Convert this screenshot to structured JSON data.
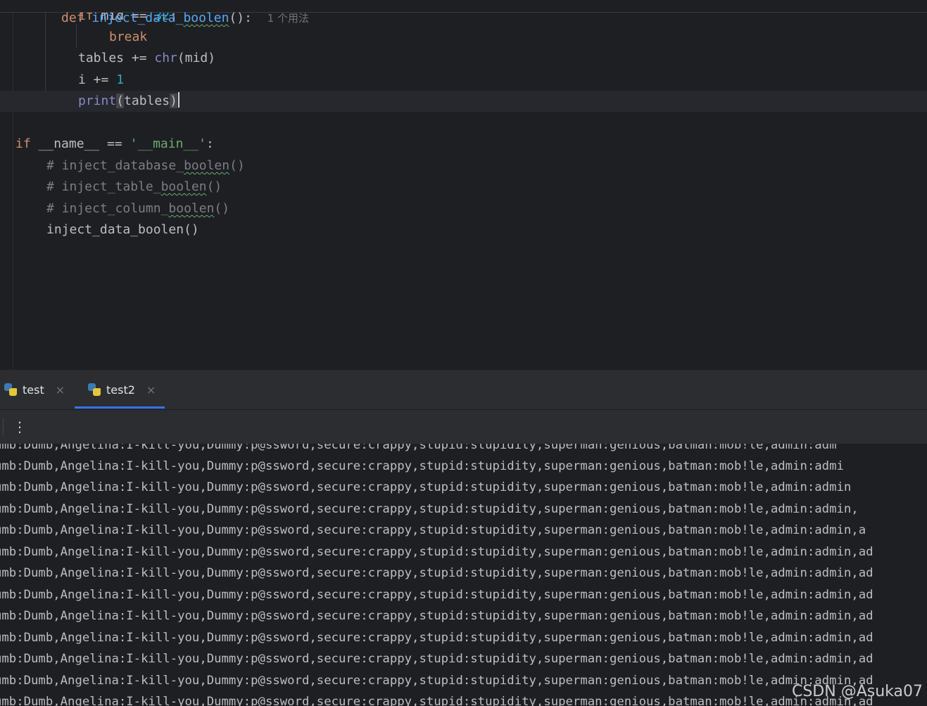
{
  "editor": {
    "sticky": {
      "kw": "def ",
      "fn": "inject_data_",
      "fn_squig": "boolen",
      "tail": "():",
      "hint": "1 个用法"
    },
    "lines": {
      "l0_kw": "if ",
      "l0_plain": "mid == ",
      "l0_num": "32",
      "l0_tail": ":",
      "l1_kw": "break",
      "l2_plain": "tables += ",
      "l2_builtin": "chr",
      "l2_tail": "(mid)",
      "l3_plain": "i += ",
      "l3_num": "1",
      "l4_builtin": "print",
      "l4_open": "(",
      "l4_arg": "tables",
      "l4_close": ")",
      "l6_kw": "if ",
      "l6_plain": "__name__ == ",
      "l6_str": "'__main__'",
      "l6_tail": ":",
      "l7_cmt": "# inject_database_",
      "l7_squig": "boolen",
      "l7_tail": "()",
      "l8_cmt": "# inject_table_",
      "l8_squig": "boolen",
      "l8_tail": "()",
      "l9_cmt": "# inject_column_",
      "l9_squig": "boolen",
      "l9_tail": "()",
      "l10_plain": "inject_data_boolen()"
    }
  },
  "run_panel": {
    "tabs": [
      {
        "label": "test",
        "close": "×"
      },
      {
        "label": "test2",
        "close": "×"
      }
    ],
    "active_tab": "test2",
    "menu_icon": "⋮",
    "output": [
      "umb:Dumb,Angelina:I-kill-you,Dummy:p@ssword,secure:crappy,stupid:stupidity,superman:genious,batman:mob!le,admin:adm",
      "umb:Dumb,Angelina:I-kill-you,Dummy:p@ssword,secure:crappy,stupid:stupidity,superman:genious,batman:mob!le,admin:admi",
      "umb:Dumb,Angelina:I-kill-you,Dummy:p@ssword,secure:crappy,stupid:stupidity,superman:genious,batman:mob!le,admin:admin",
      "umb:Dumb,Angelina:I-kill-you,Dummy:p@ssword,secure:crappy,stupid:stupidity,superman:genious,batman:mob!le,admin:admin,",
      "umb:Dumb,Angelina:I-kill-you,Dummy:p@ssword,secure:crappy,stupid:stupidity,superman:genious,batman:mob!le,admin:admin,a",
      "umb:Dumb,Angelina:I-kill-you,Dummy:p@ssword,secure:crappy,stupid:stupidity,superman:genious,batman:mob!le,admin:admin,ad",
      "umb:Dumb,Angelina:I-kill-you,Dummy:p@ssword,secure:crappy,stupid:stupidity,superman:genious,batman:mob!le,admin:admin,ad",
      "umb:Dumb,Angelina:I-kill-you,Dummy:p@ssword,secure:crappy,stupid:stupidity,superman:genious,batman:mob!le,admin:admin,ad",
      "umb:Dumb,Angelina:I-kill-you,Dummy:p@ssword,secure:crappy,stupid:stupidity,superman:genious,batman:mob!le,admin:admin,ad",
      "umb:Dumb,Angelina:I-kill-you,Dummy:p@ssword,secure:crappy,stupid:stupidity,superman:genious,batman:mob!le,admin:admin,ad",
      "umb:Dumb,Angelina:I-kill-you,Dummy:p@ssword,secure:crappy,stupid:stupidity,superman:genious,batman:mob!le,admin:admin,ad",
      "umb:Dumb,Angelina:I-kill-you,Dummy:p@ssword,secure:crappy,stupid:stupidity,superman:genious,batman:mob!le,admin:admin,ad",
      "umb:Dumb,Angelina:I-kill-you,Dummy:p@ssword,secure:crappy,stupid:stupidity,superman:genious,batman:mob!le,admin:admin,ad"
    ]
  },
  "watermark": "CSDN @Asuka07"
}
